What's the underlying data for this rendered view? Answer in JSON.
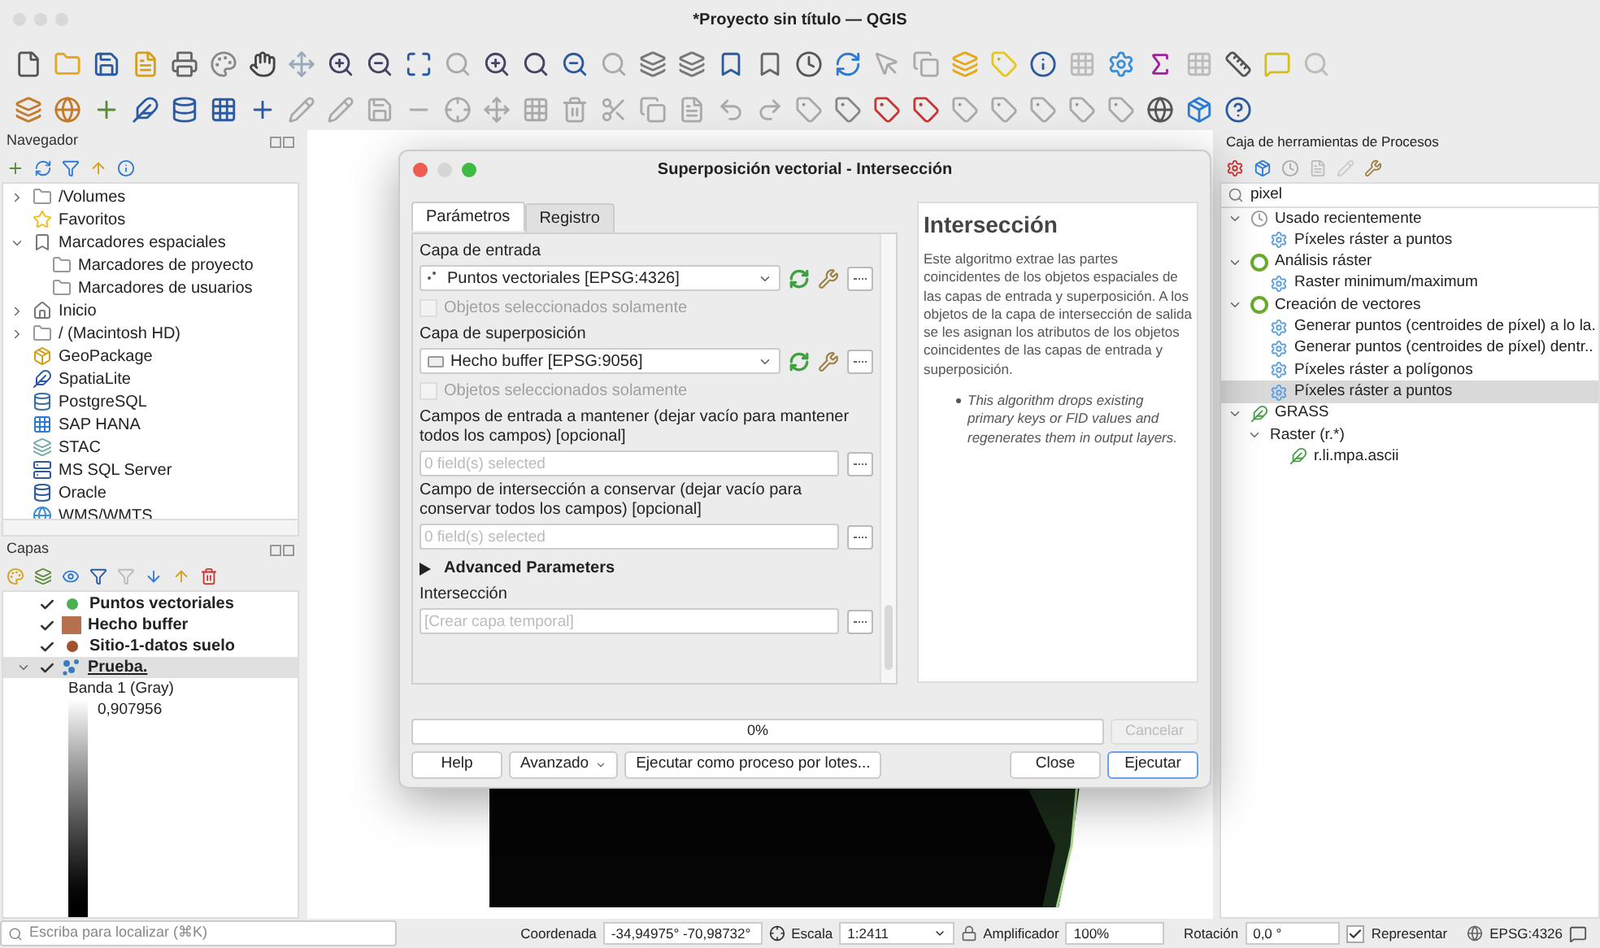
{
  "window": {
    "title": "*Proyecto sin título — QGIS"
  },
  "navigator": {
    "title": "Navegador",
    "items": [
      {
        "label": "/Volumes",
        "kind": "folder",
        "expanded": false
      },
      {
        "label": "Favoritos",
        "kind": "star"
      },
      {
        "label": "Marcadores espaciales",
        "kind": "bookmark",
        "expanded": true,
        "children": [
          {
            "label": "Marcadores de proyecto",
            "kind": "folder"
          },
          {
            "label": "Marcadores de usuarios",
            "kind": "folder"
          }
        ]
      },
      {
        "label": "Inicio",
        "kind": "home",
        "expanded": false
      },
      {
        "label": "/ (Macintosh HD)",
        "kind": "folder",
        "expanded": false
      },
      {
        "label": "GeoPackage",
        "kind": "geopackage"
      },
      {
        "label": "SpatiaLite",
        "kind": "feather"
      },
      {
        "label": "PostgreSQL",
        "kind": "database"
      },
      {
        "label": "SAP HANA",
        "kind": "square"
      },
      {
        "label": "STAC",
        "kind": "stack"
      },
      {
        "label": "MS SQL Server",
        "kind": "mssql"
      },
      {
        "label": "Oracle",
        "kind": "oracle"
      },
      {
        "label": "WMS/WMTS",
        "kind": "globe"
      }
    ]
  },
  "layers": {
    "title": "Capas",
    "items": [
      {
        "name": "Puntos vectoriales",
        "checked": true,
        "kind": "point",
        "color": "#4caf50",
        "selected": false
      },
      {
        "name": "Hecho buffer",
        "checked": true,
        "kind": "polygon",
        "color": "#b5714f",
        "selected": false
      },
      {
        "name": "Sitio-1-datos suelo",
        "checked": true,
        "kind": "point",
        "color": "#a0522d",
        "selected": false
      },
      {
        "name": "Prueba.",
        "checked": true,
        "kind": "raster",
        "color": "#3b7bbf",
        "selected": true,
        "expanded": true,
        "band": "Banda 1 (Gray)",
        "max": "0,907956"
      }
    ]
  },
  "toolbox": {
    "title": "Caja de herramientas de Procesos",
    "search": "pixel",
    "items": [
      {
        "label": "Usado recientemente",
        "kind": "clock",
        "expanded": true,
        "selected": false,
        "children": [
          {
            "label": "Píxeles ráster a puntos",
            "kind": "gear",
            "selected": false
          }
        ]
      },
      {
        "label": "Análisis ráster",
        "kind": "qgis",
        "expanded": true,
        "selected": false,
        "children": [
          {
            "label": "Raster minimum/maximum",
            "kind": "gear",
            "selected": false
          }
        ]
      },
      {
        "label": "Creación de vectores",
        "kind": "qgis",
        "expanded": true,
        "selected": false,
        "children": [
          {
            "label": "Generar puntos (centroides de píxel) a lo la.",
            "kind": "gear",
            "selected": false
          },
          {
            "label": "Generar puntos (centroides de píxel) dentr..",
            "kind": "gear",
            "selected": false
          },
          {
            "label": "Píxeles ráster a polígonos",
            "kind": "gear",
            "selected": false
          },
          {
            "label": "Píxeles ráster a puntos",
            "kind": "gear",
            "selected": true
          }
        ]
      },
      {
        "label": "GRASS",
        "kind": "grass",
        "expanded": true,
        "selected": false,
        "children": [
          {
            "label": "Raster (r.*)",
            "kind": "none",
            "expanded": true,
            "selected": false,
            "children": [
              {
                "label": "r.li.mpa.ascii",
                "kind": "grass",
                "selected": false
              }
            ]
          }
        ]
      }
    ]
  },
  "dialog": {
    "title": "Superposición vectorial - Intersección",
    "tabs": [
      {
        "label": "Parámetros",
        "selected": true
      },
      {
        "label": "Registro",
        "selected": false
      }
    ],
    "params": [
      {
        "kind": "label",
        "text": "Capa de entrada"
      },
      {
        "kind": "pointlayer",
        "value": "Puntos vectoriales [EPSG:4326]"
      },
      {
        "kind": "checkbox",
        "text": "Objetos seleccionados solamente",
        "checked": false,
        "disabled": true
      },
      {
        "kind": "label",
        "text": "Capa de superposición"
      },
      {
        "kind": "polygonlayer",
        "value": "Hecho buffer [EPSG:9056]"
      },
      {
        "kind": "checkbox",
        "text": "Objetos seleccionados solamente",
        "checked": false,
        "disabled": true
      },
      {
        "kind": "label",
        "text": "Campos de entrada a mantener (dejar vacío para mantener todos los campos) [opcional]"
      },
      {
        "kind": "fields",
        "placeholder": "0 field(s) selected"
      },
      {
        "kind": "label",
        "text": "Campo de intersección a conservar (dejar vacío para conservar todos los campos) [opcional]"
      },
      {
        "kind": "fields",
        "placeholder": "0 field(s) selected"
      },
      {
        "kind": "section",
        "text": "Advanced Parameters",
        "expanded": false
      },
      {
        "kind": "label",
        "text": "Intersección"
      },
      {
        "kind": "output",
        "placeholder": "[Crear capa temporal]"
      }
    ],
    "help": {
      "title": "Intersección",
      "text": "Este algoritmo extrae las partes coincidentes de los objetos espaciales de las capas de entrada y superposición. A los objetos de la capa de intersección de salida se les asignan los atributos de los objetos coincidentes de las capas de entrada y superposición.",
      "bullet": "This algorithm drops existing primary keys or FID values and regenerates them in output layers."
    },
    "progress": {
      "text": "0%",
      "level": 0
    },
    "cancel": {
      "label": "Cancelar",
      "disabled": true
    },
    "buttons_left": [
      {
        "label": "Help",
        "kind": "plain"
      },
      {
        "label": "Avanzado",
        "kind": "menu"
      },
      {
        "label": "Ejecutar como proceso por lotes...",
        "kind": "plain"
      }
    ],
    "buttons_right": [
      {
        "label": "Close",
        "kind": "plain"
      },
      {
        "label": "Ejecutar",
        "kind": "default"
      }
    ]
  },
  "status_bar": {
    "locator_placeholder": "Escriba para localizar (⌘K)",
    "coord_label": "Coordenada",
    "coord": "-34,94975° -70,98732°",
    "scale_label": "Escala",
    "scale": "1:2411",
    "magnifier_label": "Amplificador",
    "magnifier": "100%",
    "rotation_label": "Rotación",
    "rotation": "0,0 °",
    "render_label": "Representar",
    "render": true,
    "crs": "EPSG:4326"
  }
}
